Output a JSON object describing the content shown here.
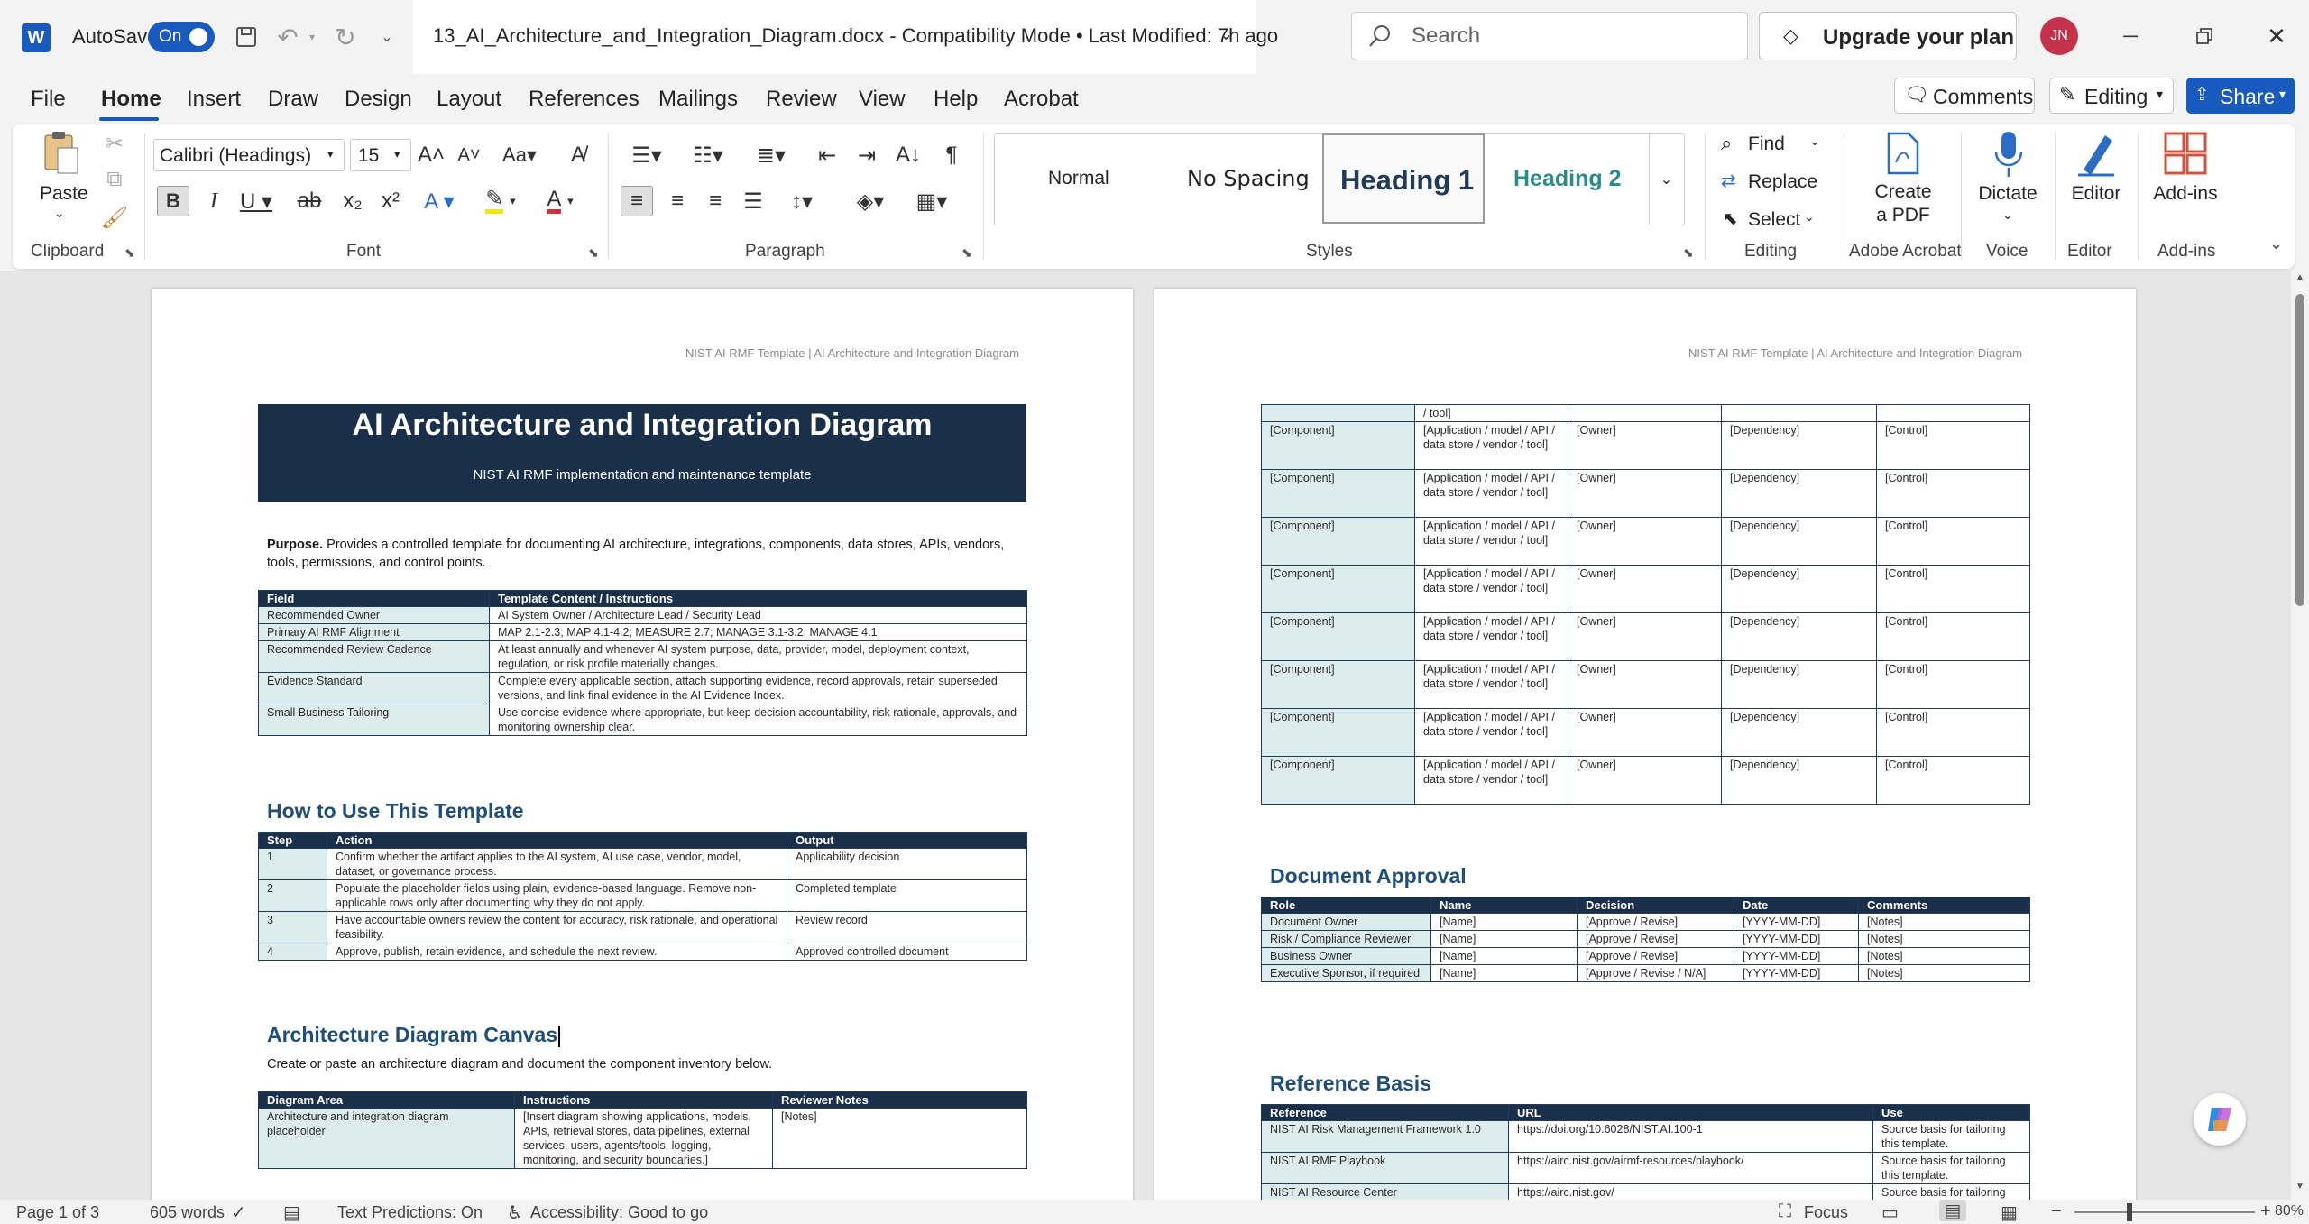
{
  "titlebar": {
    "autosave_label": "AutoSave",
    "autosave_state": "On",
    "doc_title": "13_AI_Architecture_and_Integration_Diagram.docx  -  Compatibility Mode  •  Last Modified: 7h ago",
    "search_placeholder": "Search",
    "upgrade_label": "Upgrade your plan",
    "avatar_initials": "JN"
  },
  "menu": {
    "tabs": [
      "File",
      "Home",
      "Insert",
      "Draw",
      "Design",
      "Layout",
      "References",
      "Mailings",
      "Review",
      "View",
      "Help",
      "Acrobat"
    ],
    "comments_label": "Comments",
    "editing_label": "Editing",
    "share_label": "Share"
  },
  "ribbon": {
    "clipboard": {
      "paste_label": "Paste",
      "group_label": "Clipboard"
    },
    "font": {
      "font_name": "Calibri (Headings)",
      "font_size": "15",
      "group_label": "Font"
    },
    "paragraph": {
      "group_label": "Paragraph"
    },
    "styles": {
      "items": [
        "Normal",
        "No Spacing",
        "Heading 1",
        "Heading 2"
      ],
      "group_label": "Styles"
    },
    "editing": {
      "find_label": "Find",
      "replace_label": "Replace",
      "select_label": "Select",
      "group_label": "Editing"
    },
    "acrobat": {
      "line1": "Create",
      "line2": "a PDF",
      "group_label": "Adobe Acrobat"
    },
    "voice": {
      "dictate_label": "Dictate",
      "group_label": "Voice"
    },
    "editor": {
      "editor_label": "Editor",
      "group_label": "Editor"
    },
    "addins": {
      "addins_label": "Add-ins",
      "group_label": "Add-ins"
    }
  },
  "page1": {
    "header_note": "NIST AI RMF Template | AI Architecture and Integration Diagram",
    "banner_title": "AI Architecture and Integration Diagram",
    "banner_subtitle": "NIST AI RMF implementation and maintenance template",
    "purpose_label": "Purpose.",
    "purpose_text": " Provides a controlled template for documenting AI architecture, integrations, components, data stores, APIs, vendors, tools, permissions, and control points.",
    "info_table": {
      "headers": [
        "Field",
        "Template Content / Instructions"
      ],
      "rows": [
        [
          "Recommended Owner",
          "AI System Owner / Architecture Lead / Security Lead"
        ],
        [
          "Primary AI RMF Alignment",
          "MAP 2.1-2.3; MAP 4.1-4.2; MEASURE 2.7; MANAGE 3.1-3.2; MANAGE 4.1"
        ],
        [
          "Recommended Review Cadence",
          "At least annually and whenever AI system purpose, data, provider, model, deployment context, regulation, or risk profile materially changes."
        ],
        [
          "Evidence Standard",
          "Complete every applicable section, attach supporting evidence, record approvals, retain superseded versions, and link final evidence in the AI Evidence Index."
        ],
        [
          "Small Business Tailoring",
          "Use concise evidence where appropriate, but keep decision accountability, risk rationale, approvals, and monitoring ownership clear."
        ]
      ]
    },
    "howto_heading": "How to Use This Template",
    "howto_table": {
      "headers": [
        "Step",
        "Action",
        "Output"
      ],
      "rows": [
        [
          "1",
          "Confirm whether the artifact applies to the AI system, AI use case, vendor, model, dataset, or governance process.",
          "Applicability decision"
        ],
        [
          "2",
          "Populate the placeholder fields using plain, evidence-based language. Remove non-applicable rows only after documenting why they do not apply.",
          "Completed template"
        ],
        [
          "3",
          "Have accountable owners review the content for accuracy, risk rationale, and operational feasibility.",
          "Review record"
        ],
        [
          "4",
          "Approve, publish, retain evidence, and schedule the next review.",
          "Approved controlled document"
        ]
      ]
    },
    "canvas_heading": "Architecture Diagram Canvas",
    "canvas_intro": "Create or paste an architecture diagram and document the component inventory below.",
    "canvas_table": {
      "headers": [
        "Diagram Area",
        "Instructions",
        "Reviewer Notes"
      ],
      "rows": [
        [
          "Architecture and integration diagram placeholder",
          "[Insert diagram showing applications, models, APIs, retrieval stores, data pipelines, external services, users, agents/tools, logging, monitoring, and security boundaries.]",
          "[Notes]"
        ]
      ]
    }
  },
  "page2": {
    "header_note": "NIST AI RMF Template | AI Architecture and Integration Diagram",
    "component_top_fragment": "/ tool]",
    "component_rows": [
      [
        "[Component]",
        "[Application / model / API / data store / vendor / tool]",
        "[Owner]",
        "[Dependency]",
        "[Control]"
      ],
      [
        "[Component]",
        "[Application / model / API / data store / vendor / tool]",
        "[Owner]",
        "[Dependency]",
        "[Control]"
      ],
      [
        "[Component]",
        "[Application / model / API / data store / vendor / tool]",
        "[Owner]",
        "[Dependency]",
        "[Control]"
      ],
      [
        "[Component]",
        "[Application / model / API / data store / vendor / tool]",
        "[Owner]",
        "[Dependency]",
        "[Control]"
      ],
      [
        "[Component]",
        "[Application / model / API / data store / vendor / tool]",
        "[Owner]",
        "[Dependency]",
        "[Control]"
      ],
      [
        "[Component]",
        "[Application / model / API / data store / vendor / tool]",
        "[Owner]",
        "[Dependency]",
        "[Control]"
      ],
      [
        "[Component]",
        "[Application / model / API / data store / vendor / tool]",
        "[Owner]",
        "[Dependency]",
        "[Control]"
      ],
      [
        "[Component]",
        "[Application / model / API / data store / vendor / tool]",
        "[Owner]",
        "[Dependency]",
        "[Control]"
      ]
    ],
    "approval_heading": "Document Approval",
    "approval_table": {
      "headers": [
        "Role",
        "Name",
        "Decision",
        "Date",
        "Comments"
      ],
      "rows": [
        [
          "Document Owner",
          "[Name]",
          "[Approve / Revise]",
          "[YYYY-MM-DD]",
          "[Notes]"
        ],
        [
          "Risk / Compliance Reviewer",
          "[Name]",
          "[Approve / Revise]",
          "[YYYY-MM-DD]",
          "[Notes]"
        ],
        [
          "Business Owner",
          "[Name]",
          "[Approve / Revise]",
          "[YYYY-MM-DD]",
          "[Notes]"
        ],
        [
          "Executive Sponsor, if required",
          "[Name]",
          "[Approve / Revise / N/A]",
          "[YYYY-MM-DD]",
          "[Notes]"
        ]
      ]
    },
    "reference_heading": "Reference Basis",
    "reference_table": {
      "headers": [
        "Reference",
        "URL",
        "Use"
      ],
      "rows": [
        [
          "NIST AI Risk Management Framework 1.0",
          "https://doi.org/10.6028/NIST.AI.100-1",
          "Source basis for tailoring this template."
        ],
        [
          "NIST AI RMF Playbook",
          "https://airc.nist.gov/airmf-resources/playbook/",
          "Source basis for tailoring this template."
        ],
        [
          "NIST AI Resource Center",
          "https://airc.nist.gov/",
          "Source basis for tailoring"
        ]
      ]
    }
  },
  "statusbar": {
    "page": "Page 1 of 3",
    "words": "605 words",
    "text_predictions": "Text Predictions: On",
    "accessibility": "Accessibility: Good to go",
    "focus": "Focus",
    "zoom": "80%"
  },
  "colors": {
    "accent": "#185abd",
    "banner": "#1a2f4a",
    "heading": "#1f4e79",
    "shade": "#ddecec"
  }
}
